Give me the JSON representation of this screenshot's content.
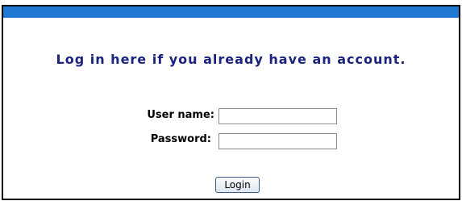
{
  "login_form": {
    "heading": "Log in here if you already have an account.",
    "username_label": "User name:",
    "username_value": "",
    "password_label": "Password:",
    "password_value": "",
    "login_button_label": "Login"
  },
  "colors": {
    "header_bar": "#1f78d1",
    "heading_text": "#1a237e",
    "panel_border": "#000000"
  }
}
